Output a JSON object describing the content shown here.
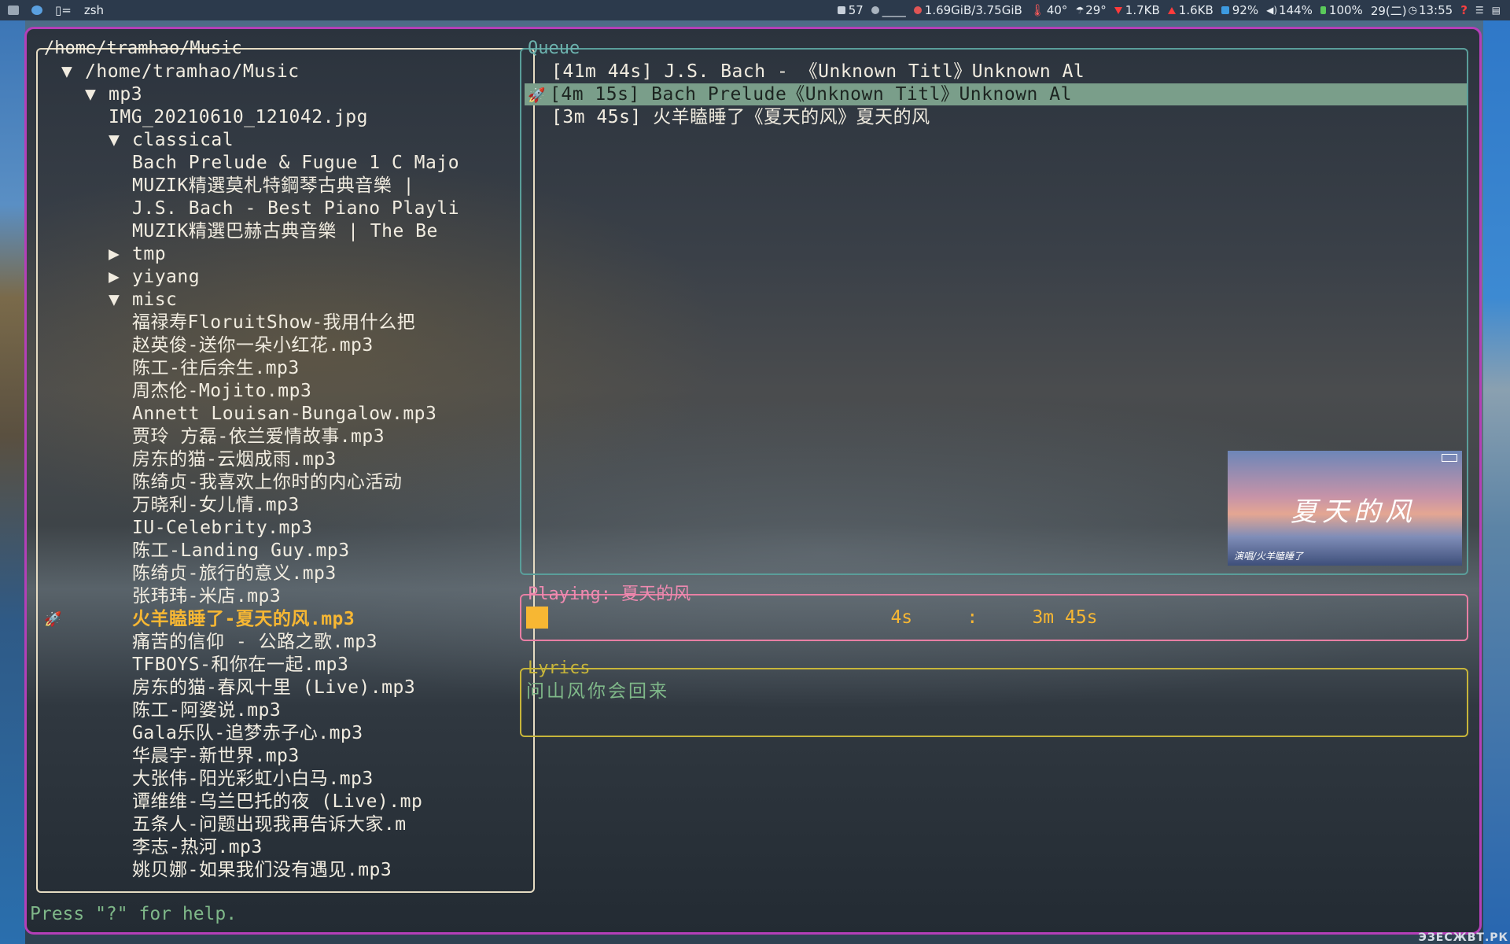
{
  "topbar": {
    "left": {
      "app": "zsh"
    },
    "right": {
      "workspace": "57",
      "cpu": "____",
      "memory": "1.69GiB/3.75GiB",
      "temp": "40°",
      "weather": "29°",
      "net_down": "1.7KB",
      "net_up": "1.6KB",
      "brightness": "92%",
      "volume": "144%",
      "battery": "100%",
      "datetime": "29(二)",
      "clock": "13:55",
      "colors": {
        "memory": "#e05555",
        "down": "#ff3b3b",
        "battery": "#5ac95a"
      }
    }
  },
  "tree": {
    "title": "/home/tramhao/Music",
    "rows": [
      {
        "caret": "▼",
        "label": "/home/tramhao/Music"
      },
      {
        "caret": "▼",
        "label": "mp3"
      },
      {
        "caret": "",
        "label": "IMG_20210610_121042.jpg"
      },
      {
        "caret": "▼",
        "label": "classical"
      },
      {
        "caret": "",
        "label": "Bach Prelude & Fugue 1 C Majo"
      },
      {
        "caret": "",
        "label": "MUZIK精選莫札特鋼琴古典音樂 |"
      },
      {
        "caret": "",
        "label": "J.S. Bach - Best Piano Playli"
      },
      {
        "caret": "",
        "label": "MUZIK精選巴赫古典音樂 | The Be"
      },
      {
        "caret": "▶",
        "label": "tmp"
      },
      {
        "caret": "▶",
        "label": "yiyang"
      },
      {
        "caret": "▼",
        "label": "misc"
      },
      {
        "caret": "",
        "label": "福禄寿FloruitShow-我用什么把"
      },
      {
        "caret": "",
        "label": "赵英俊-送你一朵小红花.mp3"
      },
      {
        "caret": "",
        "label": "陈工-往后余生.mp3"
      },
      {
        "caret": "",
        "label": "周杰伦-Mojito.mp3"
      },
      {
        "caret": "",
        "label": "Annett Louisan-Bungalow.mp3"
      },
      {
        "caret": "",
        "label": "贾玲 方磊-依兰爱情故事.mp3"
      },
      {
        "caret": "",
        "label": "房东的猫-云烟成雨.mp3"
      },
      {
        "caret": "",
        "label": "陈绮贞-我喜欢上你时的内心活动"
      },
      {
        "caret": "",
        "label": "万晓利-女儿情.mp3"
      },
      {
        "caret": "",
        "label": "IU-Celebrity.mp3"
      },
      {
        "caret": "",
        "label": "陈工-Landing Guy.mp3"
      },
      {
        "caret": "",
        "label": "陈绮贞-旅行的意义.mp3"
      },
      {
        "caret": "",
        "label": "张玮玮-米店.mp3"
      },
      {
        "caret": "",
        "label": "火羊瞌睡了-夏天的风.mp3"
      },
      {
        "caret": "",
        "label": "痛苦的信仰 - 公路之歌.mp3"
      },
      {
        "caret": "",
        "label": "TFBOYS-和你在一起.mp3"
      },
      {
        "caret": "",
        "label": "房东的猫-春风十里 (Live).mp3"
      },
      {
        "caret": "",
        "label": "陈工-阿婆说.mp3"
      },
      {
        "caret": "",
        "label": "Gala乐队-追梦赤子心.mp3"
      },
      {
        "caret": "",
        "label": "华晨宇-新世界.mp3"
      },
      {
        "caret": "",
        "label": "大张伟-阳光彩虹小白马.mp3"
      },
      {
        "caret": "",
        "label": "谭维维-乌兰巴托的夜 (Live).mp"
      },
      {
        "caret": "",
        "label": "五条人-问题出现我再告诉大家.m"
      },
      {
        "caret": "",
        "label": "李志-热河.mp3"
      },
      {
        "caret": "",
        "label": "姚贝娜-如果我们没有遇见.mp3"
      }
    ]
  },
  "queue": {
    "title": "Queue",
    "rows": [
      {
        "text": "[41m 44s] J.S. Bach - 《Unknown Titl》Unknown Al"
      },
      {
        "text": "[4m 15s] Bach Prelude《Unknown Titl》Unknown Al"
      },
      {
        "text": "[3m 45s] 火羊瞌睡了《夏天的风》夏天的风"
      }
    ],
    "cover": {
      "title": "夏天的风",
      "subtitle": "演唱/火羊瞌睡了"
    }
  },
  "playing": {
    "title": "Playing: 夏天的风",
    "progress_text": "4s     :     3m 45s",
    "progress": 0.0178
  },
  "lyrics": {
    "title": "Lyrics",
    "line": "问山风你会回来"
  },
  "status": {
    "text": "Press \"?\" for help."
  },
  "watermark": "ЭЗЕСЖВТ.РК"
}
